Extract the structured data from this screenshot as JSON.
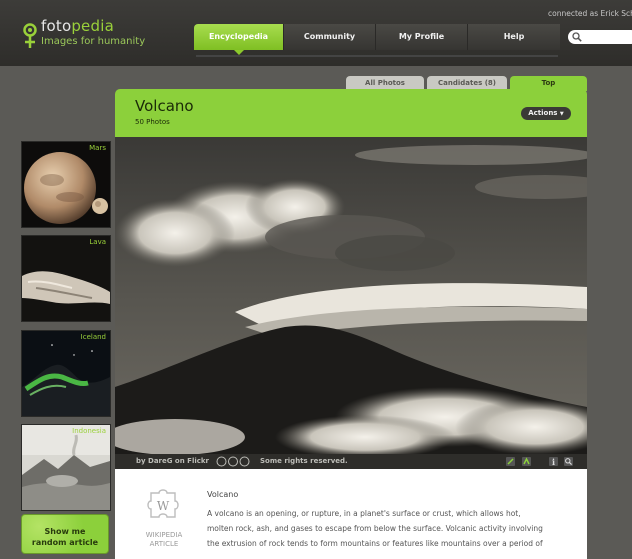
{
  "header": {
    "logo_name_prefix": "foto",
    "logo_name_suffix": "pedia",
    "tagline": "Images for humanity",
    "connected_text": "connected as Erick Sche"
  },
  "nav": {
    "tabs": [
      {
        "label": "Encyclopedia",
        "active": true
      },
      {
        "label": "Community",
        "active": false
      },
      {
        "label": "My Profile",
        "active": false
      },
      {
        "label": "Help",
        "active": false
      }
    ]
  },
  "photo_tabs": [
    {
      "label": "All Photos",
      "active": false
    },
    {
      "label": "Candidates (8)",
      "active": false
    },
    {
      "label": "Top",
      "active": true
    }
  ],
  "sidebar": {
    "thumbnails": [
      {
        "label": "Mars"
      },
      {
        "label": "Lava"
      },
      {
        "label": "Iceland"
      },
      {
        "label": "Indonesia"
      }
    ],
    "random_button": {
      "line1": "Show me",
      "line2": "random article"
    }
  },
  "panel": {
    "title": "Volcano",
    "count": "50 Photos",
    "actions_label": "Actions"
  },
  "photo_bar": {
    "credit_prefix": "by ",
    "credit_author": "DareG",
    "credit_suffix": " on Flickr",
    "rights_text": "Some rights reserved."
  },
  "article": {
    "wiki_label_line1": "WIKIPEDIA",
    "wiki_label_line2": "ARTICLE",
    "title": "Volcano",
    "lines": [
      "A volcano is an opening, or rupture, in a planet's surface or crust, which allows hot,",
      "molten rock, ash, and gases to escape from below the surface. Volcanic activity involving",
      "the extrusion of rock tends to form mountains or features like mountains over a period of"
    ]
  },
  "colors": {
    "accent_green": "#8cd03b",
    "header_dark": "#3d3c39",
    "background": "#5b5a56"
  },
  "icons": [
    "logo-icon",
    "search-icon",
    "chevron-down-icon",
    "wikipedia-puzzle-icon",
    "tools-icon",
    "share-icon",
    "info-icon",
    "zoom-icon",
    "cc-icon"
  ]
}
